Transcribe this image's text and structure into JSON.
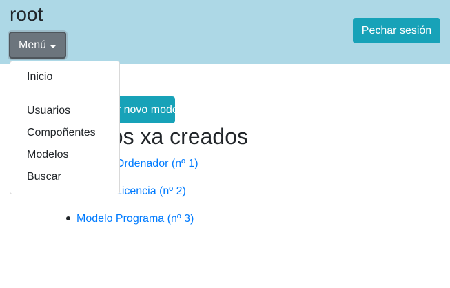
{
  "header": {
    "site_title": "root",
    "menu_label": "Menú",
    "logout_label": "Pechar sesión"
  },
  "main": {
    "add_button_label": "Engadir novo modelo",
    "section_title": "Modelos xa creados",
    "models": [
      {
        "label": "Modelo Ordenador (nº 1)"
      },
      {
        "label": "Modelo Licencia (nº 2)"
      },
      {
        "label": "Modelo Programa (nº 3)"
      }
    ]
  },
  "dropdown": {
    "items": [
      {
        "label": "Inicio"
      },
      {
        "label": "Usuarios"
      },
      {
        "label": "Compoñentes"
      },
      {
        "label": "Modelos"
      },
      {
        "label": "Buscar"
      }
    ]
  },
  "colors": {
    "header_bg": "#add8e6",
    "primary_info": "#17a2b8",
    "secondary": "#6c757d",
    "link": "#007bff"
  }
}
